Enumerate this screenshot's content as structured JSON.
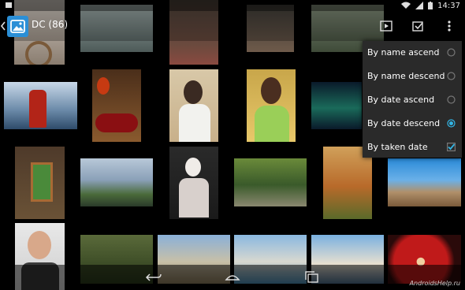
{
  "statusbar": {
    "time": "14:37",
    "icons": [
      "notification-icon",
      "wifi-icon",
      "signal-icon",
      "battery-icon"
    ]
  },
  "actionbar": {
    "title": "DC (86)",
    "icons": [
      "back-chevron-icon",
      "gallery-app-icon",
      "slideshow-icon",
      "select-icon",
      "overflow-menu-icon"
    ]
  },
  "sort_menu": {
    "items": [
      {
        "label": "By name ascend",
        "control": "radio",
        "checked": false
      },
      {
        "label": "By name descend",
        "control": "radio",
        "checked": false
      },
      {
        "label": "By date ascend",
        "control": "radio",
        "checked": false
      },
      {
        "label": "By date descend",
        "control": "radio",
        "checked": true
      },
      {
        "label": "By taken date",
        "control": "checkbox",
        "checked": true
      }
    ]
  },
  "navbar": {
    "icons": [
      "back-icon",
      "home-icon",
      "recents-icon"
    ]
  },
  "watermark": "AndroidsHelp.ru",
  "colors": {
    "accent": "#2b8fd6",
    "menu_bg": "#2a2a2a",
    "check": "#33b5e5"
  }
}
